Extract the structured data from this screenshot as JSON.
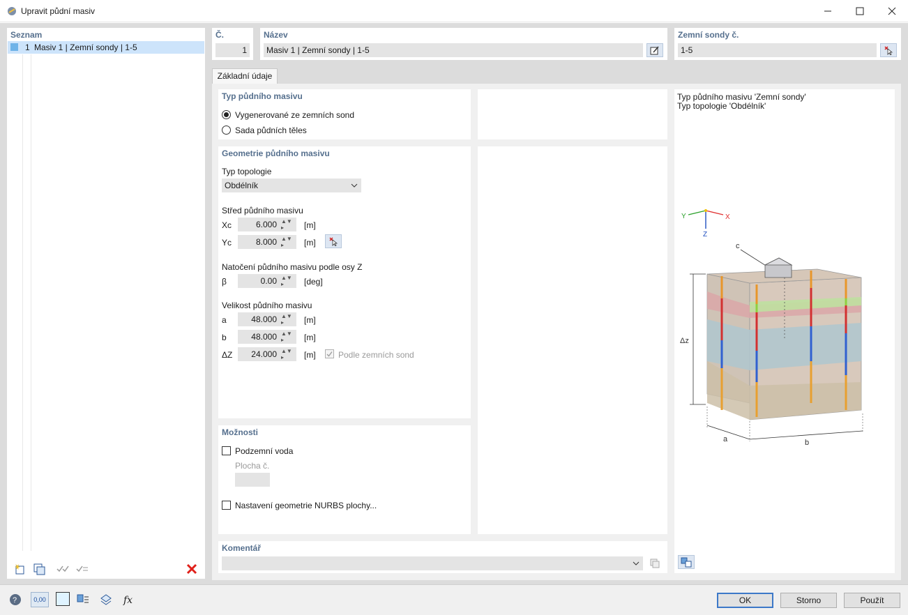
{
  "window": {
    "title": "Upravit půdní masiv"
  },
  "list": {
    "header": "Seznam",
    "items": [
      {
        "num": "1",
        "label": "Masiv 1 | Zemní sondy | 1-5"
      }
    ]
  },
  "header_fields": {
    "no_label": "Č.",
    "no_value": "1",
    "name_label": "Název",
    "name_value": "Masiv 1 | Zemní sondy | 1-5",
    "probes_label": "Zemní sondy č.",
    "probes_value": "1-5"
  },
  "tabs": [
    "Základní údaje"
  ],
  "type_section": {
    "header": "Typ půdního masivu",
    "options": [
      "Vygenerované ze zemních sond",
      "Sada půdních těles"
    ],
    "selected": 0
  },
  "geometry": {
    "header": "Geometrie půdního masivu",
    "topology_label": "Typ topologie",
    "topology_value": "Obdélník",
    "center_label": "Střed půdního masivu",
    "xc_label": "Xc",
    "xc_value": "6.000",
    "xc_unit": "[m]",
    "yc_label": "Yc",
    "yc_value": "8.000",
    "yc_unit": "[m]",
    "rotation_label": "Natočení půdního masivu podle osy Z",
    "beta_label": "β",
    "beta_value": "0.00",
    "beta_unit": "[deg]",
    "size_label": "Velikost půdního masivu",
    "a_label": "a",
    "a_value": "48.000",
    "a_unit": "[m]",
    "b_label": "b",
    "b_value": "48.000",
    "b_unit": "[m]",
    "dz_label": "ΔZ",
    "dz_value": "24.000",
    "dz_unit": "[m]",
    "by_probes_label": "Podle zemních sond"
  },
  "options": {
    "header": "Možnosti",
    "groundwater_label": "Podzemní voda",
    "surface_label": "Plocha č.",
    "nurbs_label": "Nastavení geometrie NURBS plochy..."
  },
  "comment": {
    "header": "Komentář",
    "value": ""
  },
  "preview": {
    "line1": "Typ půdního masivu 'Zemní sondy'",
    "line2": "Typ topologie 'Obdélník'",
    "axis_y": "Y",
    "axis_x": "X",
    "axis_z": "Z",
    "label_c": "c",
    "label_dz": "Δz",
    "label_a": "a",
    "label_b": "b"
  },
  "buttons": {
    "ok": "OK",
    "cancel": "Storno",
    "apply": "Použít"
  },
  "status": {
    "units_badge": "0,00"
  }
}
